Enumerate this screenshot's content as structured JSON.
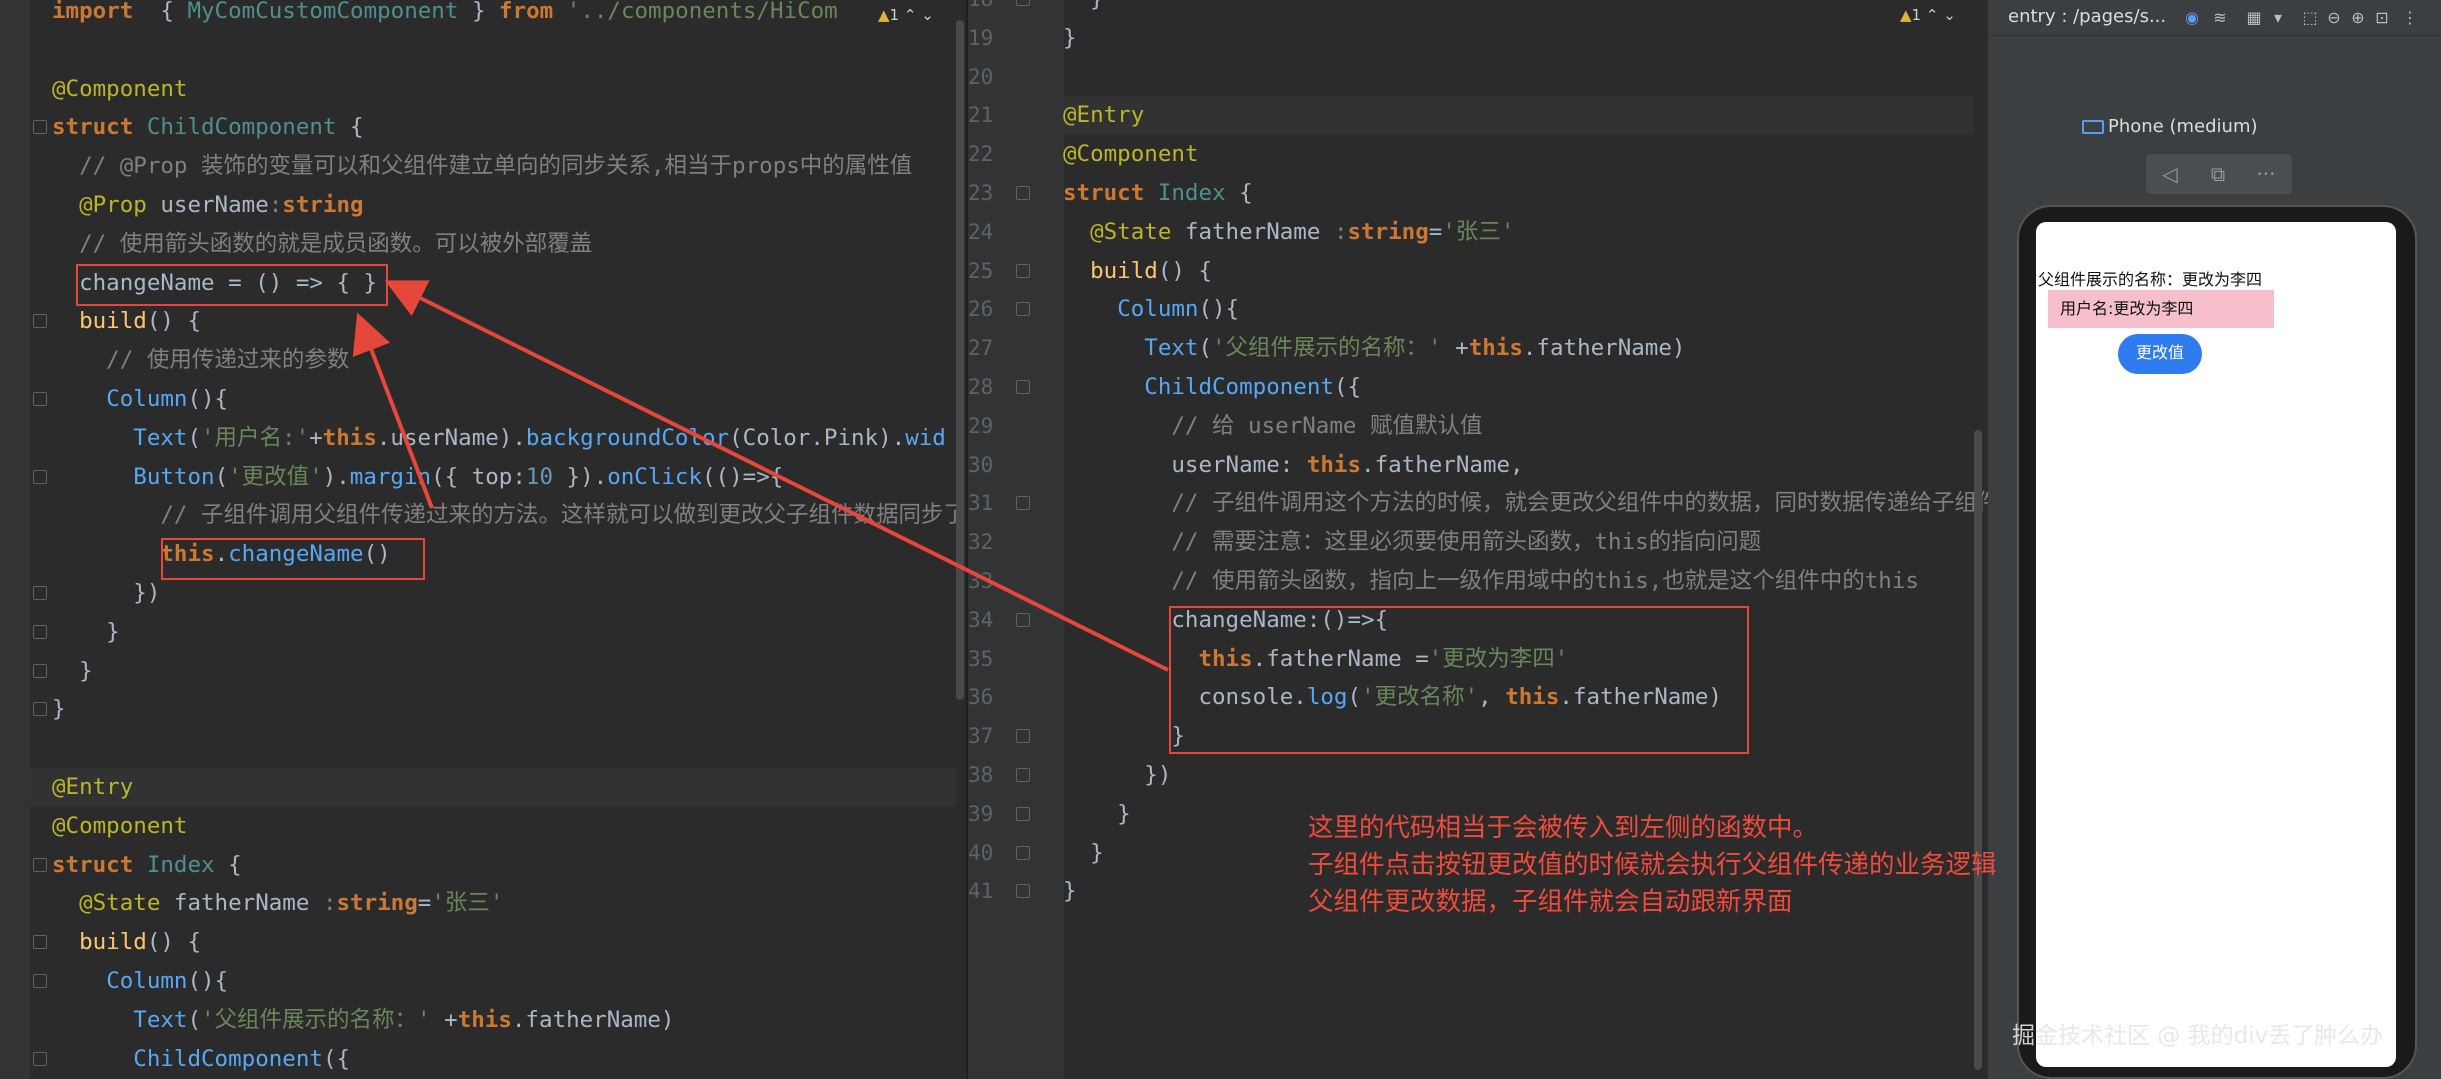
{
  "left_editor": {
    "warning_count": "1",
    "lines": [
      {
        "segments": [
          [
            "kw",
            "import"
          ],
          [
            "punct",
            "  { "
          ],
          [
            "cls-ident",
            "MyComCustomComponent"
          ],
          [
            "punct",
            " } "
          ],
          [
            "kw",
            "from"
          ],
          [
            "str",
            " '../components/HiCom"
          ]
        ]
      },
      {
        "segments": []
      },
      {
        "segments": [
          [
            "ann",
            "@Component"
          ]
        ]
      },
      {
        "segments": [
          [
            "kw",
            "struct "
          ],
          [
            "cls-ident",
            "ChildComponent"
          ],
          [
            "punct",
            " {"
          ]
        ]
      },
      {
        "segments": [
          [
            "cmt",
            "  // @Prop 装饰的变量可以和父组件建立单向的同步关系,相当于props中的属性值"
          ]
        ]
      },
      {
        "segments": [
          [
            "ann",
            "  @Prop "
          ],
          [
            "punct",
            "userName"
          ],
          [
            "typ",
            ":"
          ],
          [
            "kw",
            "string"
          ]
        ]
      },
      {
        "segments": [
          [
            "cmt",
            "  // 使用箭头函数的就是成员函数。可以被外部覆盖"
          ]
        ]
      },
      {
        "segments": [
          [
            "punct",
            "  changeName = () => { }"
          ]
        ]
      },
      {
        "segments": [
          [
            "punct",
            "  "
          ],
          [
            "fn",
            "build"
          ],
          [
            "punct",
            "() {"
          ]
        ]
      },
      {
        "segments": [
          [
            "cmt",
            "    // 使用传递过来的参数"
          ]
        ]
      },
      {
        "segments": [
          [
            "punct",
            "    "
          ],
          [
            "fnc",
            "Column"
          ],
          [
            "punct",
            "(){"
          ]
        ]
      },
      {
        "segments": [
          [
            "punct",
            "      "
          ],
          [
            "fnc",
            "Text"
          ],
          [
            "punct",
            "("
          ],
          [
            "str",
            "'用户名:'"
          ],
          [
            "punct",
            "+"
          ],
          [
            "this",
            "this"
          ],
          [
            "punct",
            ".userName)."
          ],
          [
            "fnc",
            "backgroundColor"
          ],
          [
            "punct",
            "(Color.Pink)."
          ],
          [
            "fnc",
            "wid"
          ]
        ]
      },
      {
        "segments": [
          [
            "punct",
            "      "
          ],
          [
            "fnc",
            "Button"
          ],
          [
            "punct",
            "("
          ],
          [
            "str",
            "'更改值'"
          ],
          [
            "punct",
            ")."
          ],
          [
            "fnc",
            "margin"
          ],
          [
            "punct",
            "({ top:"
          ],
          [
            "num",
            "10"
          ],
          [
            "punct",
            " })."
          ],
          [
            "fnc",
            "onClick"
          ],
          [
            "punct",
            "(()=>{"
          ]
        ]
      },
      {
        "segments": [
          [
            "cmt",
            "        // 子组件调用父组件传递过来的方法。这样就可以做到更改父子组件数据同步了"
          ]
        ]
      },
      {
        "segments": [
          [
            "punct",
            "        "
          ],
          [
            "this",
            "this"
          ],
          [
            "punct",
            "."
          ],
          [
            "fnc",
            "changeName"
          ],
          [
            "punct",
            "()"
          ]
        ]
      },
      {
        "segments": [
          [
            "punct",
            "      })"
          ]
        ]
      },
      {
        "segments": [
          [
            "punct",
            "    }"
          ]
        ]
      },
      {
        "segments": [
          [
            "punct",
            "  }"
          ]
        ]
      },
      {
        "segments": [
          [
            "punct",
            "}"
          ]
        ]
      },
      {
        "segments": []
      },
      {
        "segments": [
          [
            "ann",
            "@Entry"
          ]
        ]
      },
      {
        "segments": [
          [
            "ann",
            "@Component"
          ]
        ]
      },
      {
        "segments": [
          [
            "kw",
            "struct "
          ],
          [
            "cls-ident",
            "Index"
          ],
          [
            "punct",
            " {"
          ]
        ]
      },
      {
        "segments": [
          [
            "ann",
            "  @State "
          ],
          [
            "punct",
            "fatherName "
          ],
          [
            "typ",
            ":"
          ],
          [
            "kw",
            "string"
          ],
          [
            "punct",
            "="
          ],
          [
            "str",
            "'张三'"
          ]
        ]
      },
      {
        "segments": [
          [
            "punct",
            "  "
          ],
          [
            "fn",
            "build"
          ],
          [
            "punct",
            "() {"
          ]
        ]
      },
      {
        "segments": [
          [
            "punct",
            "    "
          ],
          [
            "fnc",
            "Column"
          ],
          [
            "punct",
            "(){"
          ]
        ]
      },
      {
        "segments": [
          [
            "punct",
            "      "
          ],
          [
            "fnc",
            "Text"
          ],
          [
            "punct",
            "("
          ],
          [
            "str",
            "'父组件展示的名称：' "
          ],
          [
            "punct",
            "+"
          ],
          [
            "this",
            "this"
          ],
          [
            "punct",
            ".fatherName)"
          ]
        ]
      },
      {
        "segments": [
          [
            "punct",
            "      "
          ],
          [
            "fnc",
            "ChildComponent"
          ],
          [
            "punct",
            "({"
          ]
        ]
      }
    ]
  },
  "right_editor": {
    "warning_count": "1",
    "line_numbers": [
      "18",
      "19",
      "20",
      "21",
      "22",
      "23",
      "24",
      "25",
      "26",
      "27",
      "28",
      "29",
      "30",
      "31",
      "32",
      "33",
      "34",
      "35",
      "36",
      "37",
      "38",
      "39",
      "40",
      "41"
    ],
    "lines": [
      {
        "segments": [
          [
            "punct",
            "  }"
          ]
        ]
      },
      {
        "segments": [
          [
            "punct",
            "}"
          ]
        ]
      },
      {
        "segments": []
      },
      {
        "segments": [
          [
            "ann",
            "@Entry"
          ]
        ]
      },
      {
        "segments": [
          [
            "ann",
            "@Component"
          ]
        ]
      },
      {
        "segments": [
          [
            "kw",
            "struct "
          ],
          [
            "cls-ident",
            "Index"
          ],
          [
            "punct",
            " {"
          ]
        ]
      },
      {
        "segments": [
          [
            "ann",
            "  @State "
          ],
          [
            "punct",
            "fatherName "
          ],
          [
            "typ",
            ":"
          ],
          [
            "kw",
            "string"
          ],
          [
            "punct",
            "="
          ],
          [
            "str",
            "'张三'"
          ]
        ]
      },
      {
        "segments": [
          [
            "punct",
            "  "
          ],
          [
            "fn",
            "build"
          ],
          [
            "punct",
            "() {"
          ]
        ]
      },
      {
        "segments": [
          [
            "punct",
            "    "
          ],
          [
            "fnc",
            "Column"
          ],
          [
            "punct",
            "(){"
          ]
        ]
      },
      {
        "segments": [
          [
            "punct",
            "      "
          ],
          [
            "fnc",
            "Text"
          ],
          [
            "punct",
            "("
          ],
          [
            "str",
            "'父组件展示的名称：' "
          ],
          [
            "punct",
            "+"
          ],
          [
            "this",
            "this"
          ],
          [
            "punct",
            ".fatherName)"
          ]
        ]
      },
      {
        "segments": [
          [
            "punct",
            "      "
          ],
          [
            "fnc",
            "ChildComponent"
          ],
          [
            "punct",
            "({"
          ]
        ]
      },
      {
        "segments": [
          [
            "cmt",
            "        // 给 userName 赋值默认值"
          ]
        ]
      },
      {
        "segments": [
          [
            "punct",
            "        userName: "
          ],
          [
            "this",
            "this"
          ],
          [
            "punct",
            ".fatherName,"
          ]
        ]
      },
      {
        "segments": [
          [
            "cmt",
            "        // 子组件调用这个方法的时候，就会更改父组件中的数据，同时数据传递给子组件"
          ]
        ]
      },
      {
        "segments": [
          [
            "cmt",
            "        // 需要注意：这里必须要使用箭头函数，this的指向问题"
          ]
        ]
      },
      {
        "segments": [
          [
            "cmt",
            "        // 使用箭头函数，指向上一级作用域中的this,也就是这个组件中的this"
          ]
        ]
      },
      {
        "segments": [
          [
            "punct",
            "        changeName:()=>{"
          ]
        ]
      },
      {
        "segments": [
          [
            "punct",
            "          "
          ],
          [
            "this",
            "this"
          ],
          [
            "punct",
            ".fatherName ="
          ],
          [
            "str",
            "'更改为李四'"
          ]
        ]
      },
      {
        "segments": [
          [
            "punct",
            "          console."
          ],
          [
            "fnc",
            "log"
          ],
          [
            "punct",
            "("
          ],
          [
            "str",
            "'更改名称'"
          ],
          [
            "punct",
            ", "
          ],
          [
            "this",
            "this"
          ],
          [
            "punct",
            ".fatherName)"
          ]
        ]
      },
      {
        "segments": [
          [
            "punct",
            "        }"
          ]
        ]
      },
      {
        "segments": [
          [
            "punct",
            "      })"
          ]
        ]
      },
      {
        "segments": [
          [
            "punct",
            "    }"
          ]
        ]
      },
      {
        "segments": [
          [
            "punct",
            "  }"
          ]
        ]
      },
      {
        "segments": [
          [
            "punct",
            "}"
          ]
        ]
      }
    ]
  },
  "annotation": {
    "lines": [
      "这里的代码相当于会被传入到左侧的函数中。",
      "子组件点击按钮更改值的时候就会执行父组件传递的业务逻辑",
      "父组件更改数据，子组件就会自动跟新界面"
    ],
    "color": "#f04b3c"
  },
  "preview": {
    "path": "entry : /pages/s...",
    "device": "Phone (medium)",
    "father_text": "父组件展示的名称：更改为李四",
    "user_text": "用户名:更改为李四",
    "button_label": "更改值"
  },
  "watermark": "掘金技术社区 @ 我的div丢了肿么办"
}
